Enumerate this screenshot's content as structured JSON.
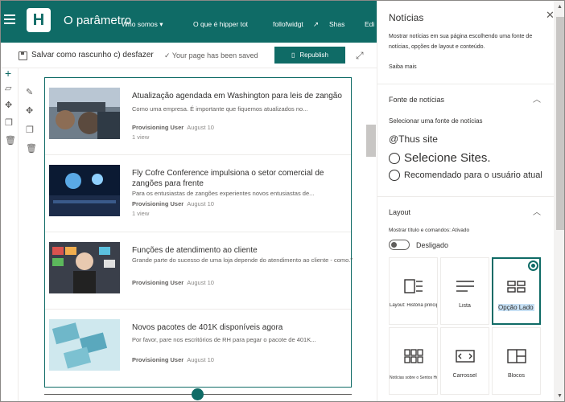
{
  "header": {
    "logo_letter": "H",
    "site_title": "O parâmetro",
    "nav": [
      "Who somos ▾",
      "O que é hipper tot",
      "follofwidgt",
      "Shas",
      "Edi"
    ]
  },
  "command_bar": {
    "save_label": "Salvar como rascunho c) desfazer",
    "saved_status": "✓ Your page has been saved",
    "republish_label": "Republish"
  },
  "news": [
    {
      "title": "Atualização agendada em Washington para leis de zangão",
      "description": "Como uma empresa.  É importante que fiquemos atualizados no...",
      "author": "Provisioning User",
      "date": "August 10",
      "views": "1 view"
    },
    {
      "title": "Fly Cofre Conference impulsiona o setor comercial de zangões para frente",
      "description": "Para os entusiastas de zangões experientes novos entusiastas de...",
      "author": "Provisioning User",
      "date": "August 10",
      "views": "1 view"
    },
    {
      "title": "Funções de atendimento ao cliente",
      "description": "Grande parte do sucesso de uma loja depende do atendimento ao cliente - como.\"",
      "author": "Provisioning User",
      "date": "August 10",
      "views": ""
    },
    {
      "title": "Novos pacotes de 401K disponíveis agora",
      "description": "Por favor, pare nos escritórios de RH para pegar o pacote de 401K...",
      "author": "Provisioning User",
      "date": "August 10",
      "views": ""
    }
  ],
  "panel": {
    "title": "Notícias",
    "description": "Mostrar notícias em sua página escolhendo uma fonte de notícias, opções de layout e conteúdo.",
    "learn_more": "Saiba mais",
    "source_section": "Fonte de notícias",
    "source_label": "Selecionar uma fonte de notícias",
    "source_selected": "@Thus site",
    "source_option_1": "Selecione Sites.",
    "source_option_2": "Recomendado para o usuário atual",
    "layout_section": "Layout",
    "show_title_label": "Mostrar título e comandos: Ativado",
    "toggle_label": "Desligado",
    "layouts": [
      {
        "label": "Layout: História principal",
        "icon": "top-story-icon"
      },
      {
        "label": "Lista",
        "icon": "list-icon"
      },
      {
        "label": "Opção Lado a lado",
        "icon": "side-by-side-icon",
        "selected": true
      },
      {
        "label": "Notícias sobre o Sentos Hub",
        "icon": "hub-news-icon"
      },
      {
        "label": "Carrossel",
        "icon": "carousel-icon"
      },
      {
        "label": "Blocos",
        "icon": "tiles-icon"
      }
    ]
  },
  "colors": {
    "brand": "#0f6b66",
    "selection": "#c7e0f4"
  }
}
